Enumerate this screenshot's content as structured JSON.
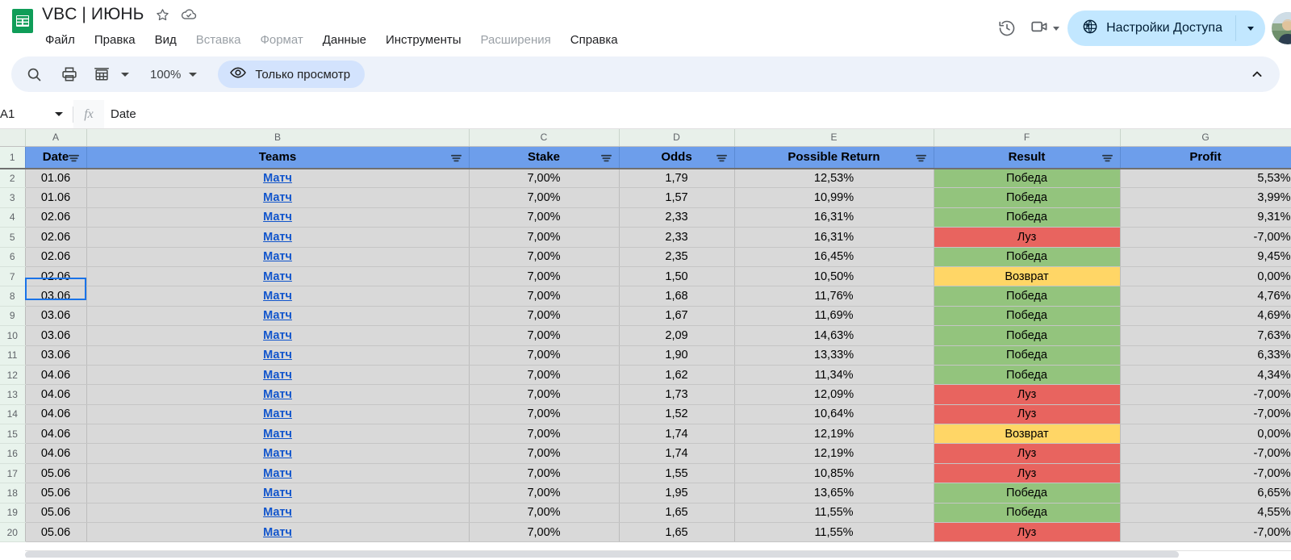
{
  "app": {
    "doc_title": "VBC | ИЮНЬ",
    "logo_icon": "sheets-logo-icon",
    "star_icon": "star-icon",
    "cloud_icon": "cloud-saved-icon"
  },
  "menu": {
    "items": [
      {
        "label": "Файл",
        "dim": false
      },
      {
        "label": "Правка",
        "dim": false
      },
      {
        "label": "Вид",
        "dim": false
      },
      {
        "label": "Вставка",
        "dim": true
      },
      {
        "label": "Формат",
        "dim": true
      },
      {
        "label": "Данные",
        "dim": false
      },
      {
        "label": "Инструменты",
        "dim": false
      },
      {
        "label": "Расширения",
        "dim": true
      },
      {
        "label": "Справка",
        "dim": false
      }
    ]
  },
  "header_actions": {
    "history_icon": "history-clock-icon",
    "meet_icon": "video-camera-icon",
    "share_label": "Настройки Доступа",
    "share_icon": "globe-icon",
    "share_bg": "#c2e7ff",
    "avatar_icon": "user-avatar"
  },
  "toolbar": {
    "search_icon": "search-icon",
    "print_icon": "print-icon",
    "view_grid_icon": "sheet-view-icon",
    "zoom_value": "100%",
    "viewonly_label": "Только просмотр",
    "viewonly_icon": "eye-icon",
    "viewonly_bg": "#d3e3fd",
    "collapse_icon": "chevron-up-icon",
    "toolbar_bg": "#edf2fa"
  },
  "formula_bar": {
    "name_box": "A1",
    "fx_label": "fx",
    "content": "Date"
  },
  "grid": {
    "columns": [
      "A",
      "B",
      "C",
      "D",
      "E",
      "F",
      "G"
    ],
    "row_numbers": [
      "1",
      "2",
      "3",
      "4",
      "5",
      "6",
      "7",
      "8",
      "9",
      "10",
      "11",
      "12",
      "13",
      "14",
      "15",
      "16",
      "17",
      "18",
      "19",
      "20"
    ],
    "header_bg": "#6d9eeb",
    "data_bg": "#d9d9d9",
    "rowhdr_bg": "#e8f3ec",
    "link_color": "#1155cc",
    "selected_cell": "A1",
    "headers": [
      {
        "label": "Date",
        "filter": true
      },
      {
        "label": "Teams",
        "filter": true
      },
      {
        "label": "Stake",
        "filter": true
      },
      {
        "label": "Odds",
        "filter": true
      },
      {
        "label": "Possible Return",
        "filter": true
      },
      {
        "label": "Result",
        "filter": true
      },
      {
        "label": "Profit",
        "filter": true
      }
    ],
    "status_colors": {
      "Победа": "#93c47d",
      "Луз": "#e8645f",
      "Возврат": "#ffd666"
    },
    "rows": [
      {
        "n": "2",
        "date": "01.06",
        "team": "Матч",
        "stake": "7,00%",
        "odds": "1,79",
        "ret": "12,53%",
        "result": "Победа",
        "profit": "5,53%"
      },
      {
        "n": "3",
        "date": "01.06",
        "team": "Матч",
        "stake": "7,00%",
        "odds": "1,57",
        "ret": "10,99%",
        "result": "Победа",
        "profit": "3,99%"
      },
      {
        "n": "4",
        "date": "02.06",
        "team": "Матч",
        "stake": "7,00%",
        "odds": "2,33",
        "ret": "16,31%",
        "result": "Победа",
        "profit": "9,31%"
      },
      {
        "n": "5",
        "date": "02.06",
        "team": "Матч",
        "stake": "7,00%",
        "odds": "2,33",
        "ret": "16,31%",
        "result": "Луз",
        "profit": "-7,00%"
      },
      {
        "n": "6",
        "date": "02.06",
        "team": "Матч",
        "stake": "7,00%",
        "odds": "2,35",
        "ret": "16,45%",
        "result": "Победа",
        "profit": "9,45%"
      },
      {
        "n": "7",
        "date": "02.06",
        "team": "Матч",
        "stake": "7,00%",
        "odds": "1,50",
        "ret": "10,50%",
        "result": "Возврат",
        "profit": "0,00%"
      },
      {
        "n": "8",
        "date": "03.06",
        "team": "Матч",
        "stake": "7,00%",
        "odds": "1,68",
        "ret": "11,76%",
        "result": "Победа",
        "profit": "4,76%"
      },
      {
        "n": "9",
        "date": "03.06",
        "team": "Матч",
        "stake": "7,00%",
        "odds": "1,67",
        "ret": "11,69%",
        "result": "Победа",
        "profit": "4,69%"
      },
      {
        "n": "10",
        "date": "03.06",
        "team": "Матч",
        "stake": "7,00%",
        "odds": "2,09",
        "ret": "14,63%",
        "result": "Победа",
        "profit": "7,63%"
      },
      {
        "n": "11",
        "date": "03.06",
        "team": "Матч",
        "stake": "7,00%",
        "odds": "1,90",
        "ret": "13,33%",
        "result": "Победа",
        "profit": "6,33%"
      },
      {
        "n": "12",
        "date": "04.06",
        "team": "Матч",
        "stake": "7,00%",
        "odds": "1,62",
        "ret": "11,34%",
        "result": "Победа",
        "profit": "4,34%"
      },
      {
        "n": "13",
        "date": "04.06",
        "team": "Матч",
        "stake": "7,00%",
        "odds": "1,73",
        "ret": "12,09%",
        "result": "Луз",
        "profit": "-7,00%"
      },
      {
        "n": "14",
        "date": "04.06",
        "team": "Матч",
        "stake": "7,00%",
        "odds": "1,52",
        "ret": "10,64%",
        "result": "Луз",
        "profit": "-7,00%"
      },
      {
        "n": "15",
        "date": "04.06",
        "team": "Матч",
        "stake": "7,00%",
        "odds": "1,74",
        "ret": "12,19%",
        "result": "Возврат",
        "profit": "0,00%"
      },
      {
        "n": "16",
        "date": "04.06",
        "team": "Матч",
        "stake": "7,00%",
        "odds": "1,74",
        "ret": "12,19%",
        "result": "Луз",
        "profit": "-7,00%"
      },
      {
        "n": "17",
        "date": "05.06",
        "team": "Матч",
        "stake": "7,00%",
        "odds": "1,55",
        "ret": "10,85%",
        "result": "Луз",
        "profit": "-7,00%"
      },
      {
        "n": "18",
        "date": "05.06",
        "team": "Матч",
        "stake": "7,00%",
        "odds": "1,95",
        "ret": "13,65%",
        "result": "Победа",
        "profit": "6,65%"
      },
      {
        "n": "19",
        "date": "05.06",
        "team": "Матч",
        "stake": "7,00%",
        "odds": "1,65",
        "ret": "11,55%",
        "result": "Победа",
        "profit": "4,55%"
      },
      {
        "n": "20",
        "date": "05.06",
        "team": "Матч",
        "stake": "7,00%",
        "odds": "1,65",
        "ret": "11,55%",
        "result": "Луз",
        "profit": "-7,00%"
      }
    ]
  }
}
